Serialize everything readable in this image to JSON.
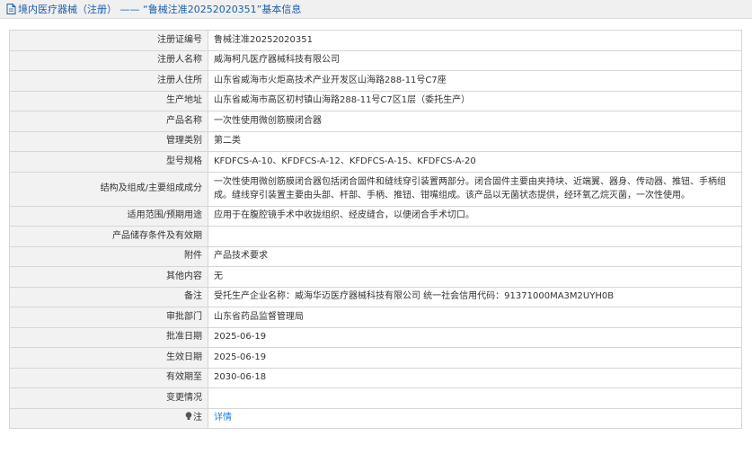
{
  "header": {
    "breadcrumb_category": "境内医疗器械（注册）",
    "separator": " —— ",
    "record_title": "“鲁械注准20252020351”基本信息",
    "accent": "#1c5fa8"
  },
  "rows": [
    {
      "label": "注册证编号",
      "value": "鲁械注准20252020351"
    },
    {
      "label": "注册人名称",
      "value": "威海柯凡医疗器械科技有限公司"
    },
    {
      "label": "注册人住所",
      "value": "山东省威海市火炬高技术产业开发区山海路288-11号C7座"
    },
    {
      "label": "生产地址",
      "value": "山东省威海市高区初村镇山海路288-11号C7区1层（委托生产）"
    },
    {
      "label": "产品名称",
      "value": "一次性使用微创筋膜闭合器"
    },
    {
      "label": "管理类别",
      "value": "第二类"
    },
    {
      "label": "型号规格",
      "value": "KFDFCS-A-10、KFDFCS-A-12、KFDFCS-A-15、KFDFCS-A-20"
    },
    {
      "label": "结构及组成/主要组成成分",
      "value": "一次性使用微创筋膜闭合器包括闭合固件和缝线穿引装置两部分。闭合固件主要由夹持块、近端翼、器身、传动器、推钮、手柄组成。缝线穿引装置主要由头部、杆部、手柄、推钮、钳嘴组成。该产品以无菌状态提供，经环氧乙烷灭菌，一次性使用。"
    },
    {
      "label": "适用范围/预期用途",
      "value": "应用于在腹腔镜手术中收拢组织、经皮缝合，以便闭合手术切口。"
    },
    {
      "label": "产品储存条件及有效期",
      "value": ""
    },
    {
      "label": "附件",
      "value": "产品技术要求"
    },
    {
      "label": "其他内容",
      "value": "无"
    },
    {
      "label": "备注",
      "value": "受托生产企业名称：威海华迈医疗器械科技有限公司 统一社会信用代码：91371000MA3M2UYH0B"
    },
    {
      "label": "审批部门",
      "value": "山东省药品监督管理局"
    },
    {
      "label": "批准日期",
      "value": "2025-06-19"
    },
    {
      "label": "生效日期",
      "value": "2025-06-19"
    },
    {
      "label": "有效期至",
      "value": "2030-06-18"
    },
    {
      "label": "变更情况",
      "value": ""
    }
  ],
  "note_row": {
    "label": "注",
    "icon": "lightbulb-icon",
    "link_text": "详情"
  }
}
